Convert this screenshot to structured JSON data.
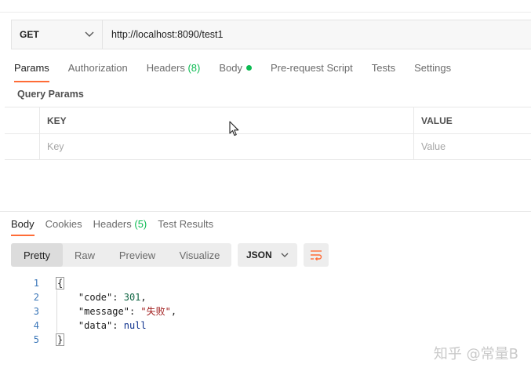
{
  "request": {
    "method": "GET",
    "url": "http://localhost:8090/test1"
  },
  "request_tabs": [
    {
      "label": "Params"
    },
    {
      "label": "Authorization"
    },
    {
      "label": "Headers",
      "count": "(8)"
    },
    {
      "label": "Body"
    },
    {
      "label": "Pre-request Script"
    },
    {
      "label": "Tests"
    },
    {
      "label": "Settings"
    }
  ],
  "query_params": {
    "title": "Query Params",
    "columns": {
      "key": "KEY",
      "value": "VALUE"
    },
    "placeholder": {
      "key": "Key",
      "value": "Value"
    }
  },
  "response_tabs": [
    {
      "label": "Body"
    },
    {
      "label": "Cookies"
    },
    {
      "label": "Headers",
      "count": "(5)"
    },
    {
      "label": "Test Results"
    }
  ],
  "view_modes": [
    "Pretty",
    "Raw",
    "Preview",
    "Visualize"
  ],
  "format": "JSON",
  "response_code": {
    "line_numbers": [
      "1",
      "2",
      "3",
      "4",
      "5"
    ],
    "open_brace": "{",
    "close_brace": "}",
    "fields": [
      {
        "key": "\"code\"",
        "value": "301"
      },
      {
        "key": "\"message\"",
        "value": "\"失败\""
      },
      {
        "key": "\"data\"",
        "value": "null"
      }
    ]
  },
  "watermark": "知乎 @常量B",
  "colors": {
    "accent": "#ff6c37",
    "count": "#0cbb52"
  }
}
